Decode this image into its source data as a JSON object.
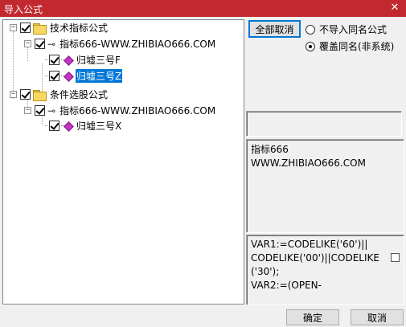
{
  "window": {
    "title": "导入公式",
    "close_glyph": "✕"
  },
  "tree": {
    "groups": [
      {
        "label": "技术指标公式",
        "expander": "−",
        "children": [
          {
            "label": "指标666-WWW.ZHIBIAO666.COM",
            "expander": "−",
            "icon": "key-icon",
            "items": [
              {
                "label": "归墟三号F",
                "checked": true,
                "selected": false
              },
              {
                "label": "归墟三号Z",
                "checked": true,
                "selected": true
              }
            ]
          }
        ]
      },
      {
        "label": "条件选股公式",
        "expander": "−",
        "children": [
          {
            "label": "指标666-WWW.ZHIBIAO666.COM",
            "expander": "−",
            "icon": "key-icon",
            "items": [
              {
                "label": "归墟三号X",
                "checked": true,
                "selected": false
              }
            ]
          }
        ]
      }
    ]
  },
  "options": {
    "cancel_all_label": "全部取消",
    "radios": [
      {
        "label": "不导入同名公式",
        "checked": false
      },
      {
        "label": "覆盖同名(非系统)",
        "checked": true
      }
    ]
  },
  "info_panel": {
    "text": "指标666\nWWW.ZHIBIAO666.COM"
  },
  "code_panel": {
    "text": "VAR1:=CODELIKE('60')||\nCODELIKE('00')||CODELIKE\n('30');\nVAR2:=(OPEN-"
  },
  "footer": {
    "ok_label": "确定",
    "cancel_label": "取消"
  },
  "colors": {
    "titlebar": "#c1292e",
    "selection": "#0078d7",
    "folder": "#f6d860",
    "formula_icon": "#c832c8"
  }
}
